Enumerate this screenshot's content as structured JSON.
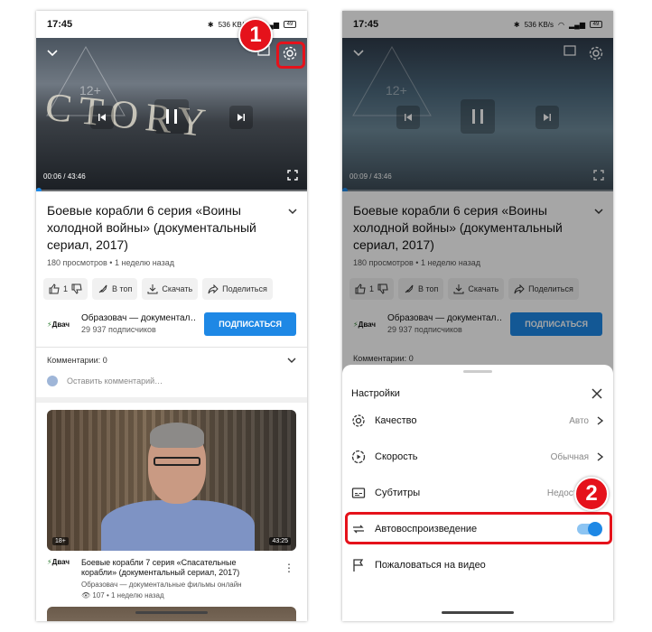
{
  "status": {
    "time": "17:45",
    "net": "536 KB/s",
    "battery": "49"
  },
  "player": {
    "phone1_time": "00:06 / 43:46",
    "phone2_time": "00:09 / 43:46",
    "rating": "12+",
    "watermark_text": "CTORY"
  },
  "video": {
    "title": "Боевые корабли 6 серия «Воины холодной войны» (документальный сериал, 2017)",
    "meta": "180 просмотров • 1 неделю назад",
    "likes": "1",
    "actions": {
      "top": "В топ",
      "download": "Скачать",
      "share": "Поделиться"
    }
  },
  "channel": {
    "logo": "Двач",
    "name": "Образовач — документал…",
    "subs": "29 937 подписчиков",
    "subscribe": "ПОДПИСАТЬСЯ"
  },
  "comments": {
    "label": "Комментарии:",
    "count": "0",
    "placeholder": "Оставить комментарий…"
  },
  "next_video": {
    "age": "18+",
    "duration": "43:25",
    "title": "Боевые корабли 7 серия «Спасательные корабли» (документальный сериал, 2017)",
    "channel": "Образовач — документальные фильмы онлайн",
    "meta": "107 • 1 неделю назад"
  },
  "settings": {
    "title": "Настройки",
    "rows": [
      {
        "label": "Качество",
        "value": "Авто"
      },
      {
        "label": "Скорость",
        "value": "Обычная"
      },
      {
        "label": "Субтитры",
        "value": "Недоступно"
      },
      {
        "label": "Автовоспроизведение",
        "value": ""
      },
      {
        "label": "Пожаловаться на видео",
        "value": ""
      }
    ],
    "autoplay_on": true
  },
  "markers": {
    "step1": "1",
    "step2": "2"
  },
  "colors": {
    "accent": "#1e88e5",
    "highlight": "#e5121b"
  }
}
